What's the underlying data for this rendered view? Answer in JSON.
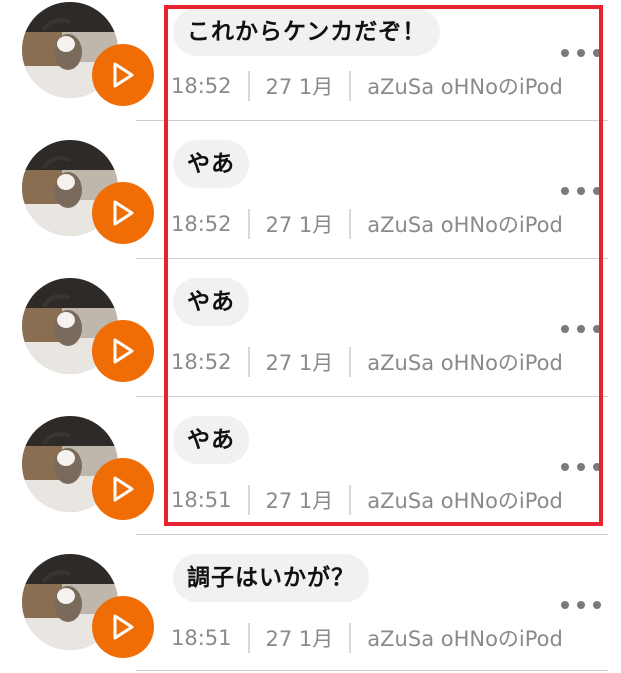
{
  "accent_color": "#f06d06",
  "highlight_color": "#e8222f",
  "messages": [
    {
      "text": "これからケンカだぞ！",
      "time": "18:52",
      "date": "27 1月",
      "device": "aZuSa oHNoのiPod"
    },
    {
      "text": "やあ",
      "time": "18:52",
      "date": "27 1月",
      "device": "aZuSa oHNoのiPod"
    },
    {
      "text": "やあ",
      "time": "18:52",
      "date": "27 1月",
      "device": "aZuSa oHNoのiPod"
    },
    {
      "text": "やあ",
      "time": "18:51",
      "date": "27 1月",
      "device": "aZuSa oHNoのiPod"
    },
    {
      "text": "調子はいかが？",
      "time": "18:51",
      "date": "27 1月",
      "device": "aZuSa oHNoのiPod"
    }
  ],
  "icons": {
    "play": "play-icon",
    "more": "more-options-icon",
    "avatar": "cat-photo-avatar"
  }
}
